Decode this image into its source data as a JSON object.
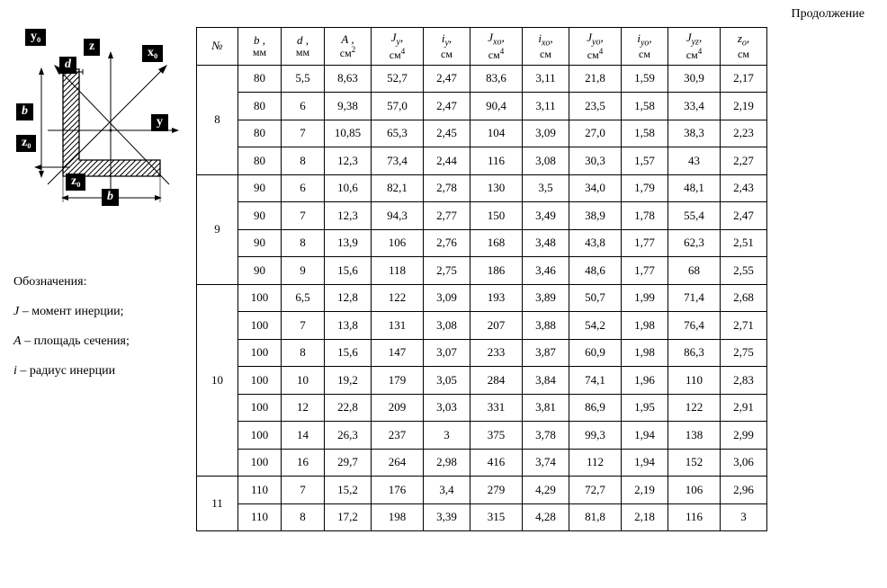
{
  "meta": {
    "continuation": "Продолжение"
  },
  "diagram": {
    "labels": {
      "y0_top": "y₀",
      "z_top": "z",
      "x0": "x₀",
      "d": "d",
      "b_left": "b",
      "y_right": "y",
      "z0_left": "z₀",
      "z0_bottom": "z₀",
      "b_bottom": "b"
    }
  },
  "notes": {
    "n1": "Обозначения:",
    "n2": "J – момент инерции;",
    "n3": "A – площадь сечения;",
    "n4": "i – радиус инерции"
  },
  "table": {
    "headers": {
      "num": {
        "sym": "№",
        "unit": ""
      },
      "b": {
        "sym": "b ,",
        "unit": "мм"
      },
      "d": {
        "sym": "d ,",
        "unit": "мм"
      },
      "A": {
        "sym": "A ,",
        "unit": "см",
        "sup": "2"
      },
      "Jy": {
        "sym": "J",
        "sub": "y",
        "comma": ",",
        "unit": "см",
        "sup": "4"
      },
      "iy": {
        "sym": "i",
        "sub": "y",
        "comma": ",",
        "unit": "см"
      },
      "Jxo": {
        "sym": "J",
        "sub": "xo",
        "comma": ",",
        "unit": "см",
        "sup": "4"
      },
      "ixo": {
        "sym": "i",
        "sub": "xo",
        "comma": ",",
        "unit": "см"
      },
      "Jyo": {
        "sym": "J",
        "sub": "yo",
        "comma": ",",
        "unit": "см",
        "sup": "4"
      },
      "iyo": {
        "sym": "i",
        "sub": "yo",
        "comma": ",",
        "unit": "см"
      },
      "Jyz": {
        "sym": "J",
        "sub": "yz",
        "comma": ",",
        "unit": "см",
        "sup": "4"
      },
      "zo": {
        "sym": "z",
        "sub": "o",
        "comma": ",",
        "unit": "см"
      }
    },
    "groups": [
      {
        "num": "8",
        "rows": [
          {
            "b": "80",
            "d": "5,5",
            "A": "8,63",
            "Jy": "52,7",
            "iy": "2,47",
            "Jxo": "83,6",
            "ixo": "3,11",
            "Jyo": "21,8",
            "iyo": "1,59",
            "Jyz": "30,9",
            "zo": "2,17"
          },
          {
            "b": "80",
            "d": "6",
            "A": "9,38",
            "Jy": "57,0",
            "iy": "2,47",
            "Jxo": "90,4",
            "ixo": "3,11",
            "Jyo": "23,5",
            "iyo": "1,58",
            "Jyz": "33,4",
            "zo": "2,19"
          },
          {
            "b": "80",
            "d": "7",
            "A": "10,85",
            "Jy": "65,3",
            "iy": "2,45",
            "Jxo": "104",
            "ixo": "3,09",
            "Jyo": "27,0",
            "iyo": "1,58",
            "Jyz": "38,3",
            "zo": "2,23"
          },
          {
            "b": "80",
            "d": "8",
            "A": "12,3",
            "Jy": "73,4",
            "iy": "2,44",
            "Jxo": "116",
            "ixo": "3,08",
            "Jyo": "30,3",
            "iyo": "1,57",
            "Jyz": "43",
            "zo": "2,27"
          }
        ]
      },
      {
        "num": "9",
        "rows": [
          {
            "b": "90",
            "d": "6",
            "A": "10,6",
            "Jy": "82,1",
            "iy": "2,78",
            "Jxo": "130",
            "ixo": "3,5",
            "Jyo": "34,0",
            "iyo": "1,79",
            "Jyz": "48,1",
            "zo": "2,43"
          },
          {
            "b": "90",
            "d": "7",
            "A": "12,3",
            "Jy": "94,3",
            "iy": "2,77",
            "Jxo": "150",
            "ixo": "3,49",
            "Jyo": "38,9",
            "iyo": "1,78",
            "Jyz": "55,4",
            "zo": "2,47"
          },
          {
            "b": "90",
            "d": "8",
            "A": "13,9",
            "Jy": "106",
            "iy": "2,76",
            "Jxo": "168",
            "ixo": "3,48",
            "Jyo": "43,8",
            "iyo": "1,77",
            "Jyz": "62,3",
            "zo": "2,51"
          },
          {
            "b": "90",
            "d": "9",
            "A": "15,6",
            "Jy": "118",
            "iy": "2,75",
            "Jxo": "186",
            "ixo": "3,46",
            "Jyo": "48,6",
            "iyo": "1,77",
            "Jyz": "68",
            "zo": "2,55"
          }
        ]
      },
      {
        "num": "10",
        "rows": [
          {
            "b": "100",
            "d": "6,5",
            "A": "12,8",
            "Jy": "122",
            "iy": "3,09",
            "Jxo": "193",
            "ixo": "3,89",
            "Jyo": "50,7",
            "iyo": "1,99",
            "Jyz": "71,4",
            "zo": "2,68"
          },
          {
            "b": "100",
            "d": "7",
            "A": "13,8",
            "Jy": "131",
            "iy": "3,08",
            "Jxo": "207",
            "ixo": "3,88",
            "Jyo": "54,2",
            "iyo": "1,98",
            "Jyz": "76,4",
            "zo": "2,71"
          },
          {
            "b": "100",
            "d": "8",
            "A": "15,6",
            "Jy": "147",
            "iy": "3,07",
            "Jxo": "233",
            "ixo": "3,87",
            "Jyo": "60,9",
            "iyo": "1,98",
            "Jyz": "86,3",
            "zo": "2,75"
          },
          {
            "b": "100",
            "d": "10",
            "A": "19,2",
            "Jy": "179",
            "iy": "3,05",
            "Jxo": "284",
            "ixo": "3,84",
            "Jyo": "74,1",
            "iyo": "1,96",
            "Jyz": "110",
            "zo": "2,83"
          },
          {
            "b": "100",
            "d": "12",
            "A": "22,8",
            "Jy": "209",
            "iy": "3,03",
            "Jxo": "331",
            "ixo": "3,81",
            "Jyo": "86,9",
            "iyo": "1,95",
            "Jyz": "122",
            "zo": "2,91"
          },
          {
            "b": "100",
            "d": "14",
            "A": "26,3",
            "Jy": "237",
            "iy": "3",
            "Jxo": "375",
            "ixo": "3,78",
            "Jyo": "99,3",
            "iyo": "1,94",
            "Jyz": "138",
            "zo": "2,99"
          },
          {
            "b": "100",
            "d": "16",
            "A": "29,7",
            "Jy": "264",
            "iy": "2,98",
            "Jxo": "416",
            "ixo": "3,74",
            "Jyo": "112",
            "iyo": "1,94",
            "Jyz": "152",
            "zo": "3,06"
          }
        ]
      },
      {
        "num": "11",
        "rows": [
          {
            "b": "110",
            "d": "7",
            "A": "15,2",
            "Jy": "176",
            "iy": "3,4",
            "Jxo": "279",
            "ixo": "4,29",
            "Jyo": "72,7",
            "iyo": "2,19",
            "Jyz": "106",
            "zo": "2,96"
          },
          {
            "b": "110",
            "d": "8",
            "A": "17,2",
            "Jy": "198",
            "iy": "3,39",
            "Jxo": "315",
            "ixo": "4,28",
            "Jyo": "81,8",
            "iyo": "2,18",
            "Jyz": "116",
            "zo": "3"
          }
        ]
      }
    ]
  }
}
